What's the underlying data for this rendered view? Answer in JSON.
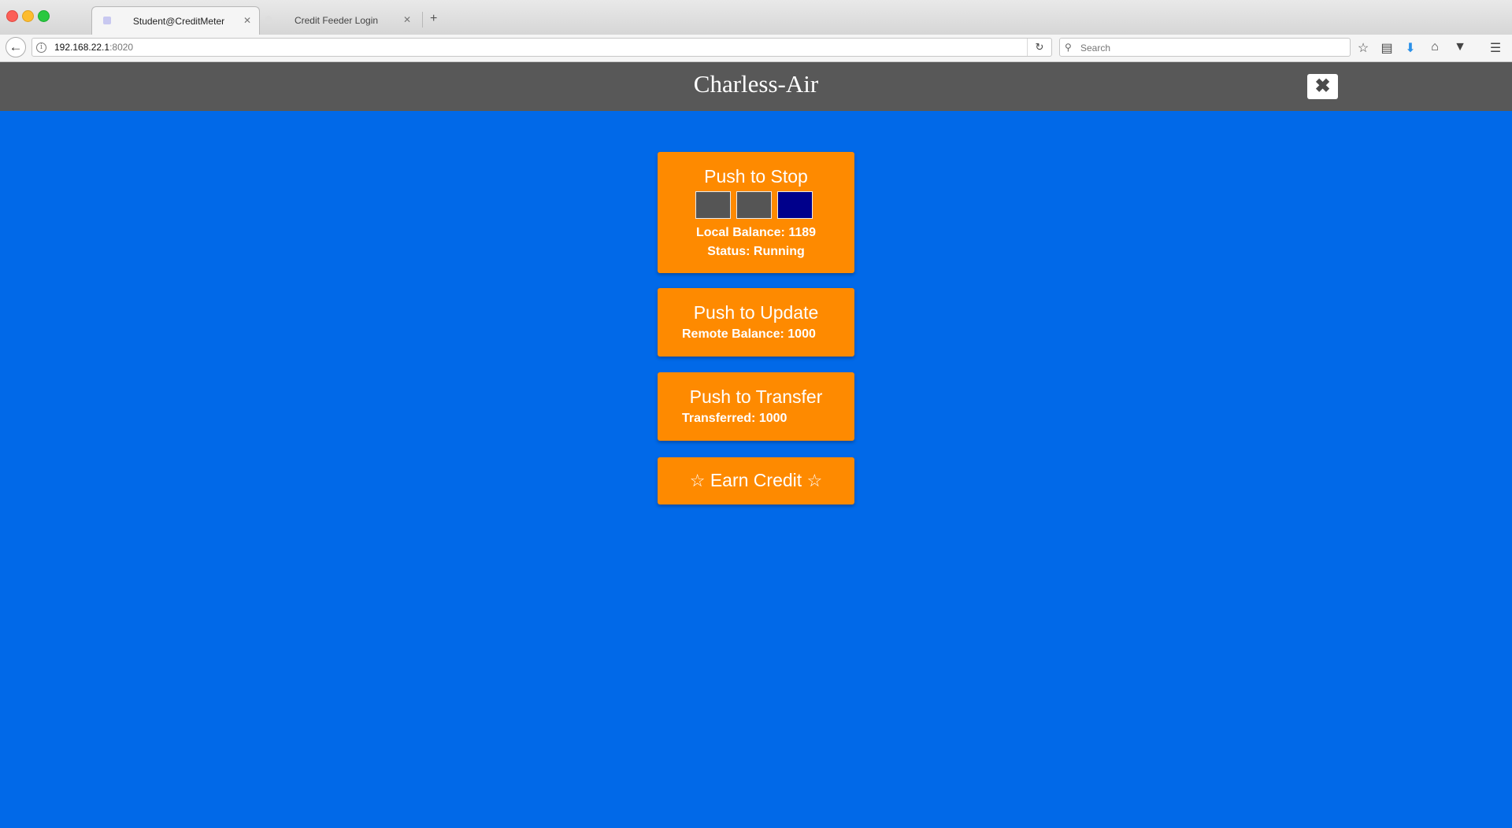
{
  "browser": {
    "tabs": [
      {
        "label": "Student@CreditMeter",
        "active": true
      },
      {
        "label": "Credit Feeder Login",
        "active": false
      }
    ],
    "tab_close_glyph": "✕",
    "new_tab_glyph": "+",
    "url_host": "192.168.22.1",
    "url_port": ":8020",
    "search_placeholder": "Search",
    "icons": [
      "back-arrow-icon",
      "info-icon",
      "reload-icon",
      "search-icon",
      "bookmark-star-icon",
      "reading-list-icon",
      "download-icon",
      "home-icon",
      "pocket-icon",
      "menu-icon"
    ]
  },
  "header": {
    "title": "Charless-Air",
    "close_glyph": "✖"
  },
  "cards": {
    "stop": {
      "title": "Push to Stop",
      "indicators": [
        {
          "color": "#555555"
        },
        {
          "color": "#555555"
        },
        {
          "color": "#00008b"
        }
      ],
      "local_balance": "Local Balance: 1189",
      "status": "Status: Running"
    },
    "update": {
      "title": "Push to Update",
      "remote_balance": "Remote Balance: 1000"
    },
    "transfer": {
      "title": "Push to Transfer",
      "transferred": "Transferred: 1000"
    },
    "earn": {
      "title": "Earn Credit",
      "star_glyph": "☆"
    }
  },
  "colors": {
    "background": "#0169e8",
    "header": "#585858",
    "card": "#fe8a00"
  }
}
